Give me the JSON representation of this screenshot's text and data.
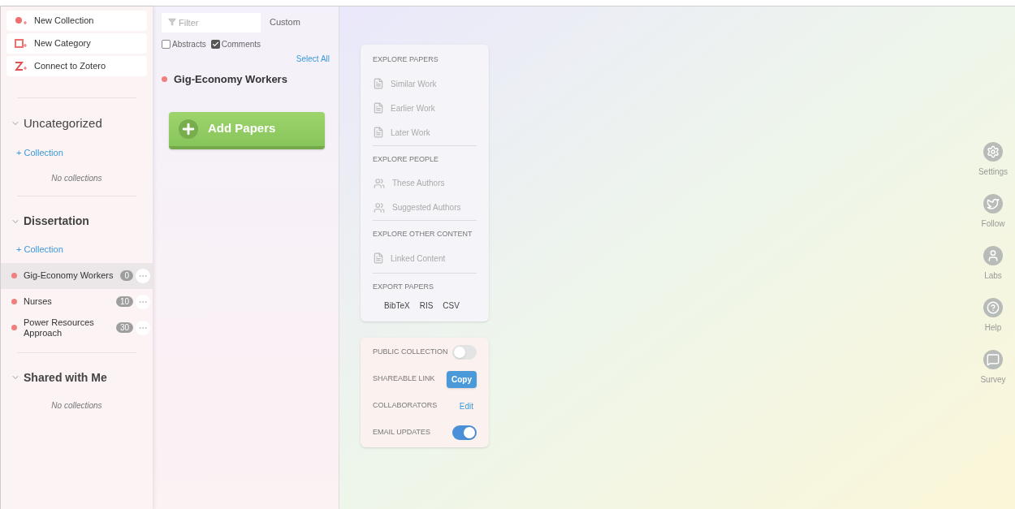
{
  "actions": [
    {
      "label": "New Collection",
      "kind": "collection"
    },
    {
      "label": "New Category",
      "kind": "category"
    },
    {
      "label": "Connect to Zotero",
      "kind": "zotero"
    }
  ],
  "sections": [
    {
      "title": "Uncategorized",
      "add_label": "+ Collection",
      "empty": "No collections"
    },
    {
      "title": "Dissertation",
      "add_label": "+ Collection",
      "collections": [
        {
          "name": "Gig-Economy Workers",
          "count": "0",
          "selected": true,
          "color": "#f08080"
        },
        {
          "name": "Nurses",
          "count": "10",
          "selected": false,
          "color": "#f08080"
        },
        {
          "name": "Power Resources Approach",
          "count": "30",
          "selected": false,
          "color": "#f08080"
        }
      ]
    },
    {
      "title": "Shared with Me",
      "empty": "No collections"
    }
  ],
  "list_panel": {
    "filter": {
      "placeholder": "Filter"
    },
    "sort_label": "Custom",
    "checkboxes": [
      {
        "label": "Abstracts",
        "checked": false
      },
      {
        "label": "Comments",
        "checked": true
      }
    ],
    "select_all": "Select All",
    "collection": {
      "name": "Gig-Economy Workers",
      "color": "#f08080"
    },
    "add_button": "Add Papers"
  },
  "explore": {
    "groups": [
      {
        "title": "EXPLORE PAPERS",
        "items": [
          {
            "label": "Similar Work",
            "kind": "paper"
          },
          {
            "label": "Earlier Work",
            "kind": "paper"
          },
          {
            "label": "Later Work",
            "kind": "paper"
          }
        ]
      },
      {
        "title": "EXPLORE PEOPLE",
        "items": [
          {
            "label": "These Authors",
            "kind": "people"
          },
          {
            "label": "Suggested Authors",
            "kind": "people"
          }
        ]
      },
      {
        "title": "EXPLORE OTHER CONTENT",
        "items": [
          {
            "label": "Linked Content",
            "kind": "paper"
          }
        ]
      }
    ],
    "export": {
      "title": "EXPORT PAPERS",
      "formats": [
        "BibTeX",
        "RIS",
        "CSV"
      ]
    }
  },
  "sharing": [
    {
      "label": "PUBLIC COLLECTION",
      "kind": "toggle",
      "on": false
    },
    {
      "label": "SHAREABLE LINK",
      "kind": "button",
      "action": "Copy"
    },
    {
      "label": "COLLABORATORS",
      "kind": "link",
      "action": "Edit"
    },
    {
      "label": "EMAIL UPDATES",
      "kind": "toggle",
      "on": true
    }
  ],
  "rail": [
    {
      "label": "Settings",
      "kind": "settings"
    },
    {
      "label": "Follow",
      "kind": "follow"
    },
    {
      "label": "Labs",
      "kind": "labs"
    },
    {
      "label": "Help",
      "kind": "help"
    },
    {
      "label": "Survey",
      "kind": "survey"
    }
  ]
}
